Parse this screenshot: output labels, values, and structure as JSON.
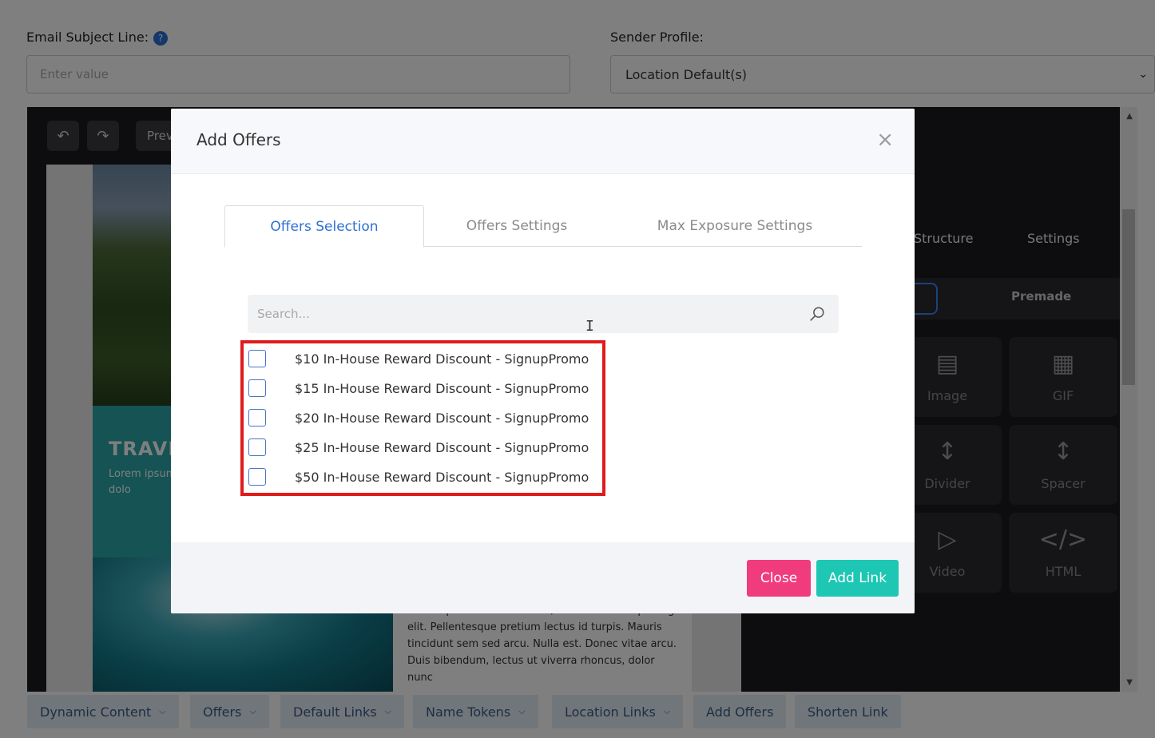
{
  "subject": {
    "label": "Email Subject Line:",
    "help": "?",
    "placeholder": "Enter value"
  },
  "sender": {
    "label": "Sender Profile:",
    "value": "Location Default(s)"
  },
  "editor": {
    "preview_label": "Prev",
    "email": {
      "teal_title": "TRAVE",
      "teal_text": "Lorem ipsum Pellentesque arcu. Nulla es rhoncus, dolo",
      "body_text": "Lorem ipsum dolor sit amet, consectetur adipiscing elit. Pellentesque pretium lectus id turpis. Mauris tincidunt sem sed arcu. Nulla est. Donec vitae arcu. Duis bibendum, lectus ut viverra rhoncus, dolor nunc"
    },
    "side": {
      "tabs": [
        "Structure",
        "Settings"
      ],
      "segment_right": "Premade",
      "tiles": [
        {
          "label": "Image",
          "icon": "image-icon"
        },
        {
          "label": "GIF",
          "icon": "film-icon"
        },
        {
          "label": "Divider",
          "icon": "divider-icon"
        },
        {
          "label": "Spacer",
          "icon": "spacer-icon"
        },
        {
          "label": "Video",
          "icon": "play-icon"
        },
        {
          "label": "HTML",
          "icon": "code-icon"
        }
      ]
    }
  },
  "bottom_bar": [
    {
      "label": "Dynamic Content",
      "dropdown": true
    },
    {
      "label": "Offers",
      "dropdown": true
    },
    {
      "label": "Default Links",
      "dropdown": true
    },
    {
      "label": "Name Tokens",
      "dropdown": true
    },
    {
      "label": "Location Links",
      "dropdown": true
    },
    {
      "label": "Add Offers",
      "dropdown": false
    },
    {
      "label": "Shorten Link",
      "dropdown": false
    }
  ],
  "modal": {
    "title": "Add Offers",
    "close_symbol": "×",
    "tabs": [
      "Offers Selection",
      "Offers Settings",
      "Max Exposure Settings"
    ],
    "active_tab": "Offers Selection",
    "search_placeholder": "Search...",
    "offers": [
      {
        "label": "$10 In-House Reward Discount - SignupPromo",
        "checked": false
      },
      {
        "label": "$15 In-House Reward Discount - SignupPromo",
        "checked": false
      },
      {
        "label": "$20 In-House Reward Discount - SignupPromo",
        "checked": false
      },
      {
        "label": "$25 In-House Reward Discount - SignupPromo",
        "checked": false
      },
      {
        "label": "$50 In-House Reward Discount - SignupPromo",
        "checked": false
      }
    ],
    "buttons": {
      "close": "Close",
      "add": "Add Link"
    }
  },
  "colors": {
    "accent_blue": "#2f6fd3",
    "close_pink": "#f03c7d",
    "add_teal": "#1dc7b3",
    "highlight_red": "#e01b1b"
  }
}
